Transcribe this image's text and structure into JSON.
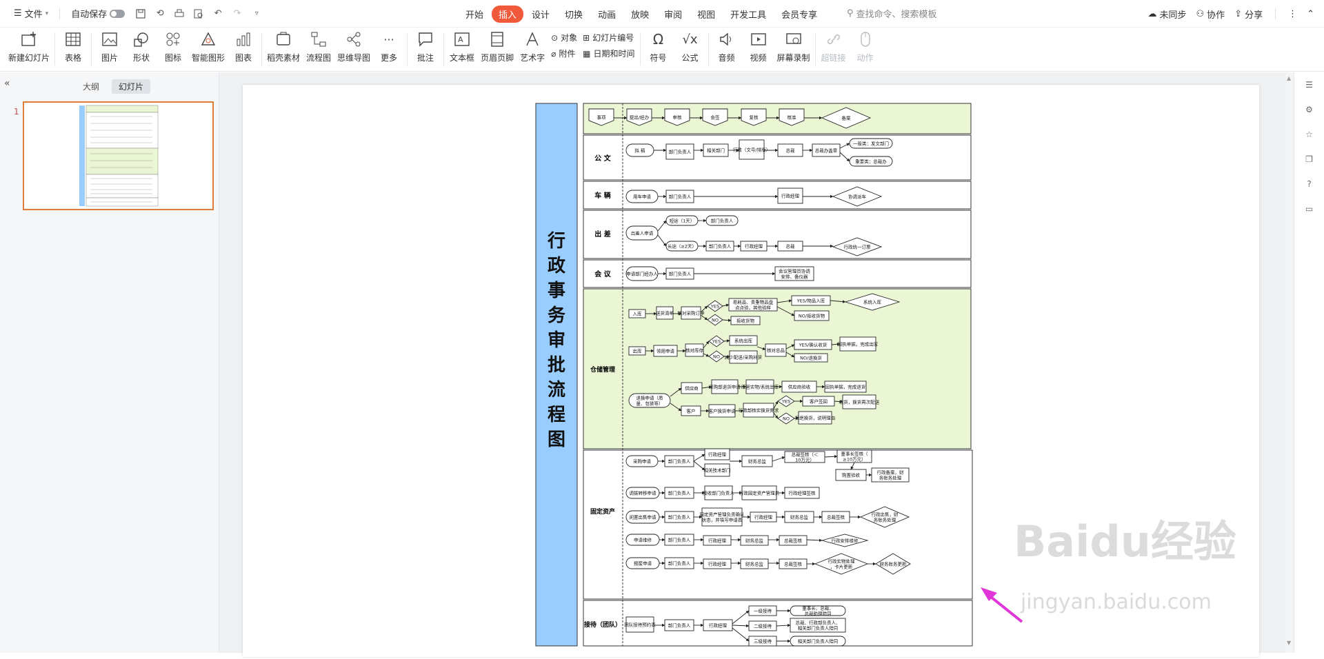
{
  "menubar": {
    "file_label": "文件",
    "autosave_label": "自动保存",
    "tabs": [
      "开始",
      "插入",
      "设计",
      "切换",
      "动画",
      "放映",
      "审阅",
      "视图",
      "开发工具",
      "会员专享"
    ],
    "active_tab": "插入",
    "search_placeholder": "查找命令、搜索模板",
    "sync_label": "未同步",
    "collab_label": "协作",
    "share_label": "分享"
  },
  "ribbon": {
    "new_slide": "新建幻灯片",
    "table": "表格",
    "picture": "图片",
    "shape": "形状",
    "icon": "图标",
    "smart_shape": "智能图形",
    "chart": "图表",
    "material": "稻壳素材",
    "flowchart": "流程图",
    "mindmap": "思维导图",
    "more": "更多",
    "comment": "批注",
    "textbox": "文本框",
    "header_footer": "页眉页脚",
    "wordart": "艺术字",
    "object": "对象",
    "slide_number": "幻灯片编号",
    "attachment": "附件",
    "datetime": "日期和时间",
    "symbol": "符号",
    "formula": "公式",
    "audio": "音频",
    "video": "视频",
    "screen_record": "屏幕录制",
    "hyperlink": "超链接",
    "action": "动作"
  },
  "leftpanel": {
    "outline_tab": "大纲",
    "slides_tab": "幻灯片",
    "slide_number": "1"
  },
  "slide": {
    "title": "行政事务审批流程图",
    "sections": {
      "row1": {
        "items": [
          "事项",
          "提出/经办",
          "审核",
          "会签",
          "复核",
          "核准",
          "备案"
        ]
      },
      "gongwen": {
        "label": "公 文",
        "items": [
          "拟 稿",
          "部门负责人",
          "相关部门",
          "行政（文号/排版）",
          "总裁",
          "总裁办盖章",
          "一般类：发文部门",
          "重要类：总裁办"
        ]
      },
      "cheliang": {
        "label": "车 辆",
        "items": [
          "用车申请",
          "部门负责人",
          "行政经理",
          "协调派车"
        ]
      },
      "chuchai": {
        "label": "出 差",
        "items": [
          "出差人申请",
          "短途（1天）",
          "部门负责人",
          "长途（≥2天）",
          "部门负责人",
          "行政经理",
          "总裁",
          "行政统一订票"
        ]
      },
      "huiyi": {
        "label": "会 议",
        "items": [
          "申请部门经办人",
          "部门负责人",
          "会议管理员协调安排、备仪器"
        ]
      },
      "cangchu": {
        "label": "仓储管理",
        "items": [
          "入库",
          "送货清单",
          "核对采购订单",
          "YES",
          "NO",
          "易耗品、贵重物品盘点点验，其他验样",
          "拒收货物",
          "YES/物品入库",
          "NO/拒收货物",
          "系统入库",
          "出库",
          "领用申请",
          "核对库存",
          "系统出库",
          "减少配送/采购补货",
          "核对总品",
          "YES/确认收货",
          "NO/退换货",
          "回执单据，完成出库",
          "退换申请（质量、包装等）",
          "供应商",
          "采购部退货申请",
          "库管实物/系统出库",
          "供应商验收",
          "回执单据，完成退货",
          "客户",
          "客户换货申请",
          "行政部核实换货需求",
          "客户签回",
          "收货，换货再次配送",
          "拒绝换货，说明理由"
        ]
      },
      "guding": {
        "label": "固定资产",
        "items": [
          "采购申请",
          "部门负责人",
          "行政经理",
          "相关技术部门",
          "财务总监",
          "总裁签核（＜10万元）",
          "董事长签核（≥10万元）",
          "购置验收",
          "行政备案，财务账务处理",
          "调拨转移申请",
          "部门负责人",
          "接收部门负责人",
          "行政固定资产管理员",
          "行政经理签核",
          "闲置出售申请",
          "部门负责人",
          "固定资产管理负责确认状态，并填写申请表",
          "行政经理",
          "财务总监",
          "总裁签核",
          "行政出售，财务账务处理",
          "申请维修",
          "部门负责人",
          "行政经理",
          "财务总监",
          "总裁签核",
          "行政安排维修",
          "报废申请",
          "部门负责人",
          "行政经理",
          "财务总监",
          "总裁签核",
          "行政实物处理，卡片更新",
          "财务账务更新"
        ]
      },
      "jiedai": {
        "label": "接待（团队）",
        "items": [
          "团队接待预约表",
          "部门负责人",
          "行政经理",
          "一级接待",
          "二级接待",
          "三级接待",
          "董事长、总裁、总裁助理陪同",
          "总裁、行政部负责人、相关部门负责人陪同",
          "相关部门负责人陪同"
        ]
      }
    }
  },
  "watermark": {
    "brand": "Baidu经验",
    "url": "jingyan.baidu.com"
  },
  "colors": {
    "accent": "#f05a3a",
    "title_bar": "#99ccff",
    "section_green": "#ebf7d4",
    "arrow": "#e036d8"
  }
}
